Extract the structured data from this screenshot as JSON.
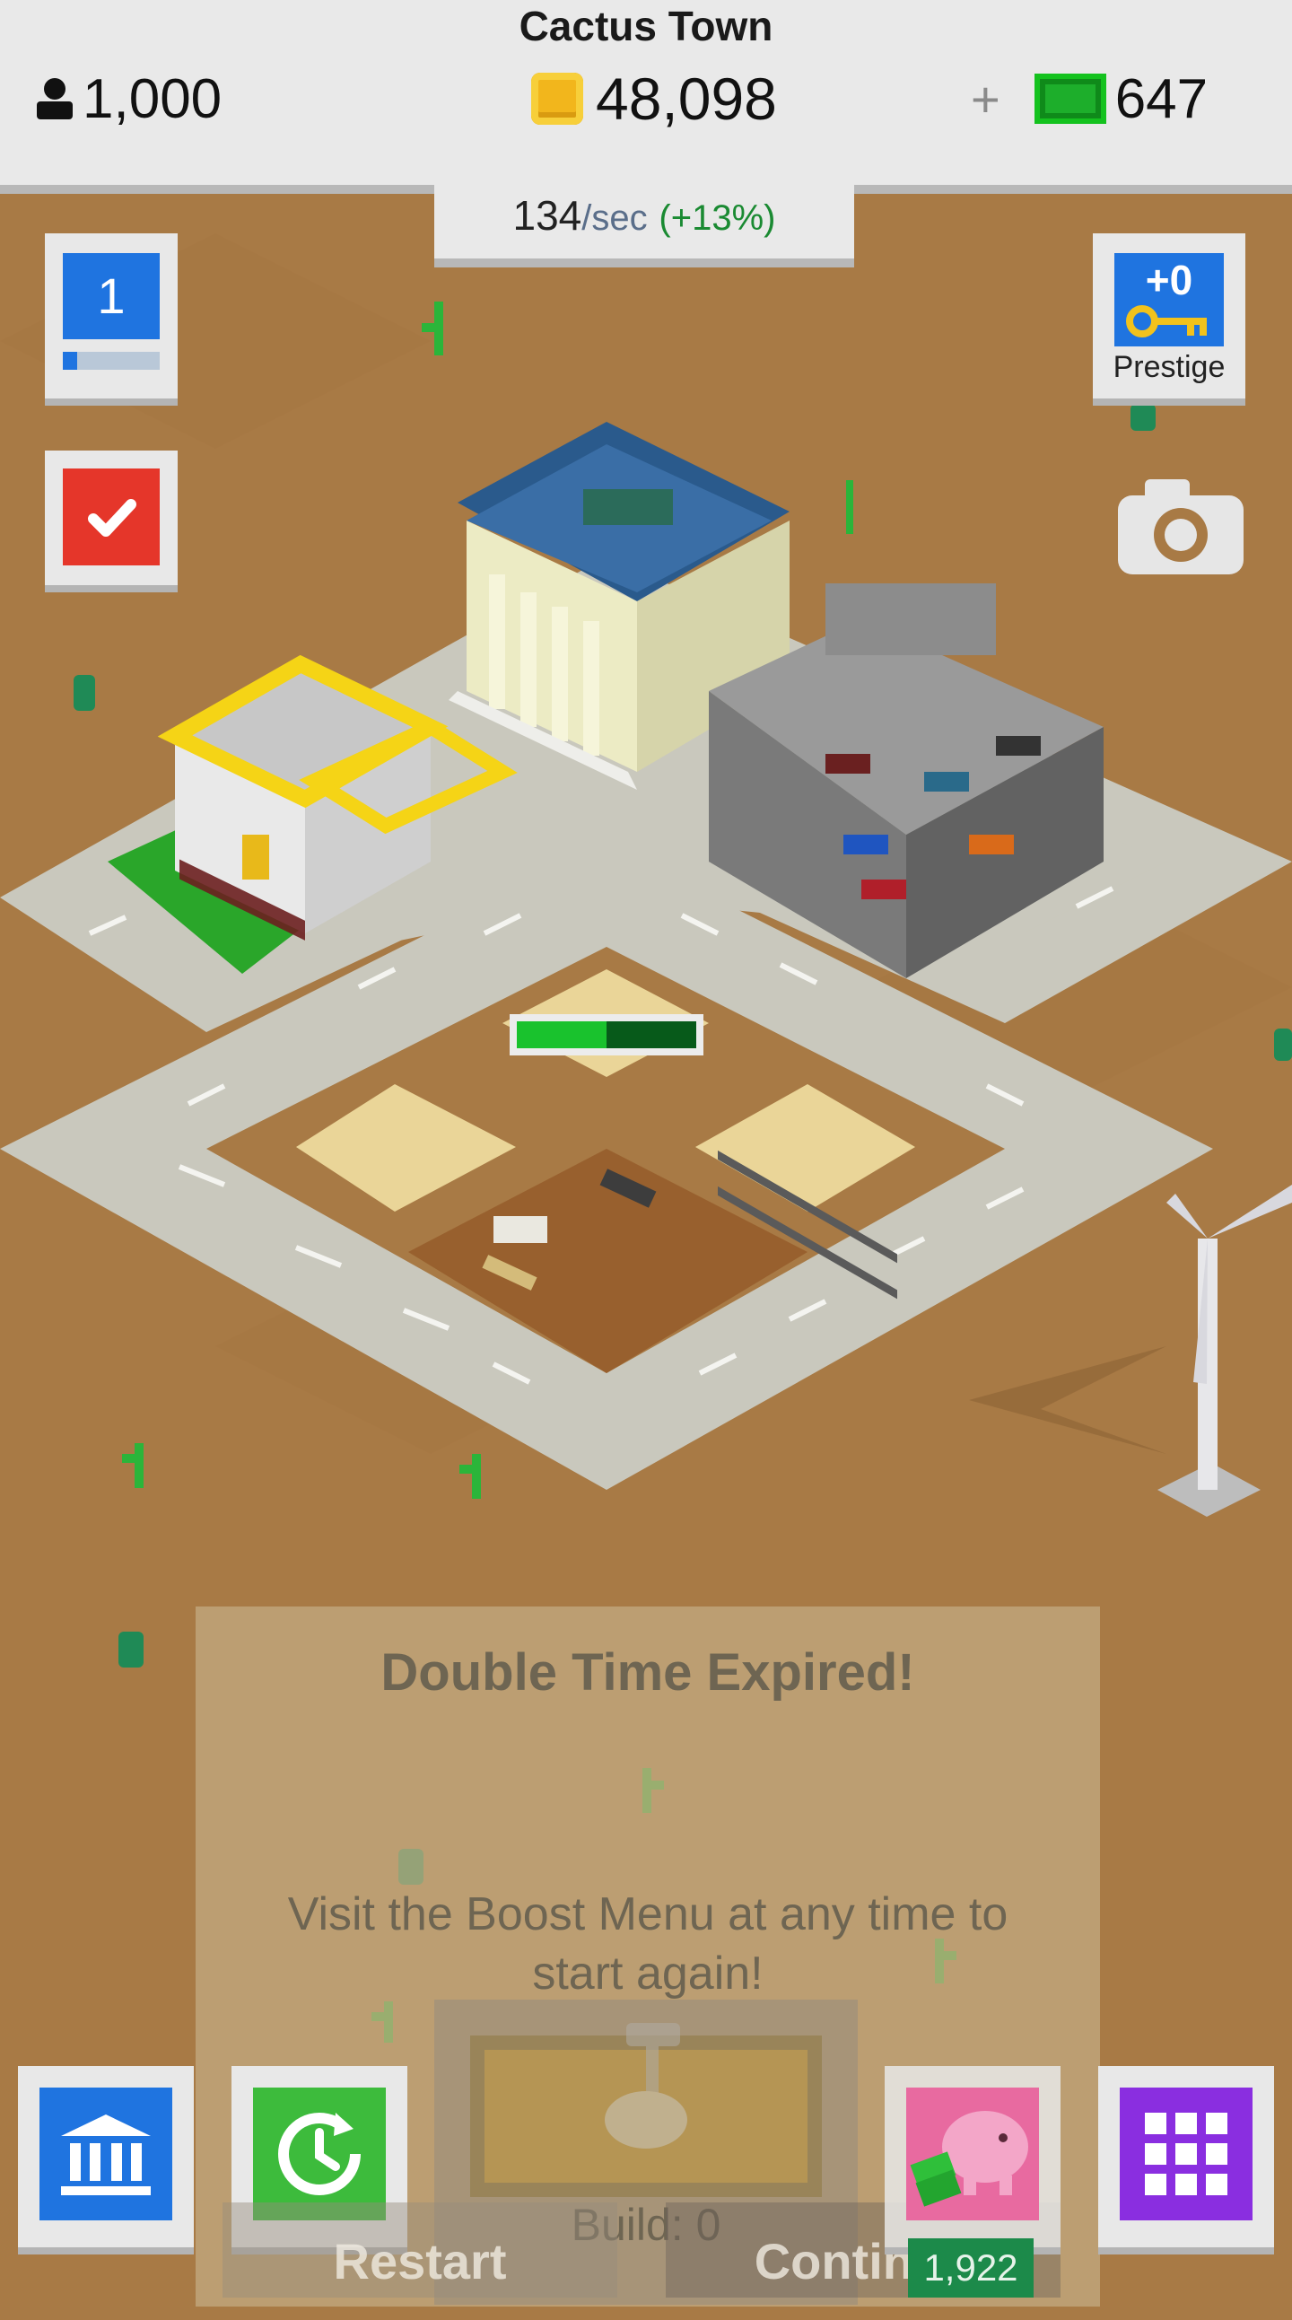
{
  "header": {
    "town_name": "Cactus Town",
    "population": "1,000",
    "coins": "48,098",
    "plus": "+",
    "cash": "647",
    "rate_value": "134",
    "rate_unit": "/sec",
    "rate_bonus": "(+13%)"
  },
  "side": {
    "level": "1",
    "level_progress": 0.15,
    "prestige_value": "+0",
    "prestige_label": "Prestige"
  },
  "map": {
    "construction_progress": 0.5
  },
  "modal": {
    "title": "Double Time Expired!",
    "message": "Visit the Boost Menu at any time to start again!",
    "build_label": "Build: 0",
    "restart_label": "Restart",
    "continue_label": "Continue"
  },
  "bottom_nav": {
    "piggy_count": "1,922"
  },
  "colors": {
    "ground": "#a87a45",
    "road": "#c9c8bd",
    "sand_pad": "#ead598",
    "accent_blue": "#1f74e0",
    "accent_red": "#e5362a",
    "accent_green": "#3dbb3c",
    "accent_purple": "#8a2ee0",
    "accent_pink": "#e86aa0"
  }
}
